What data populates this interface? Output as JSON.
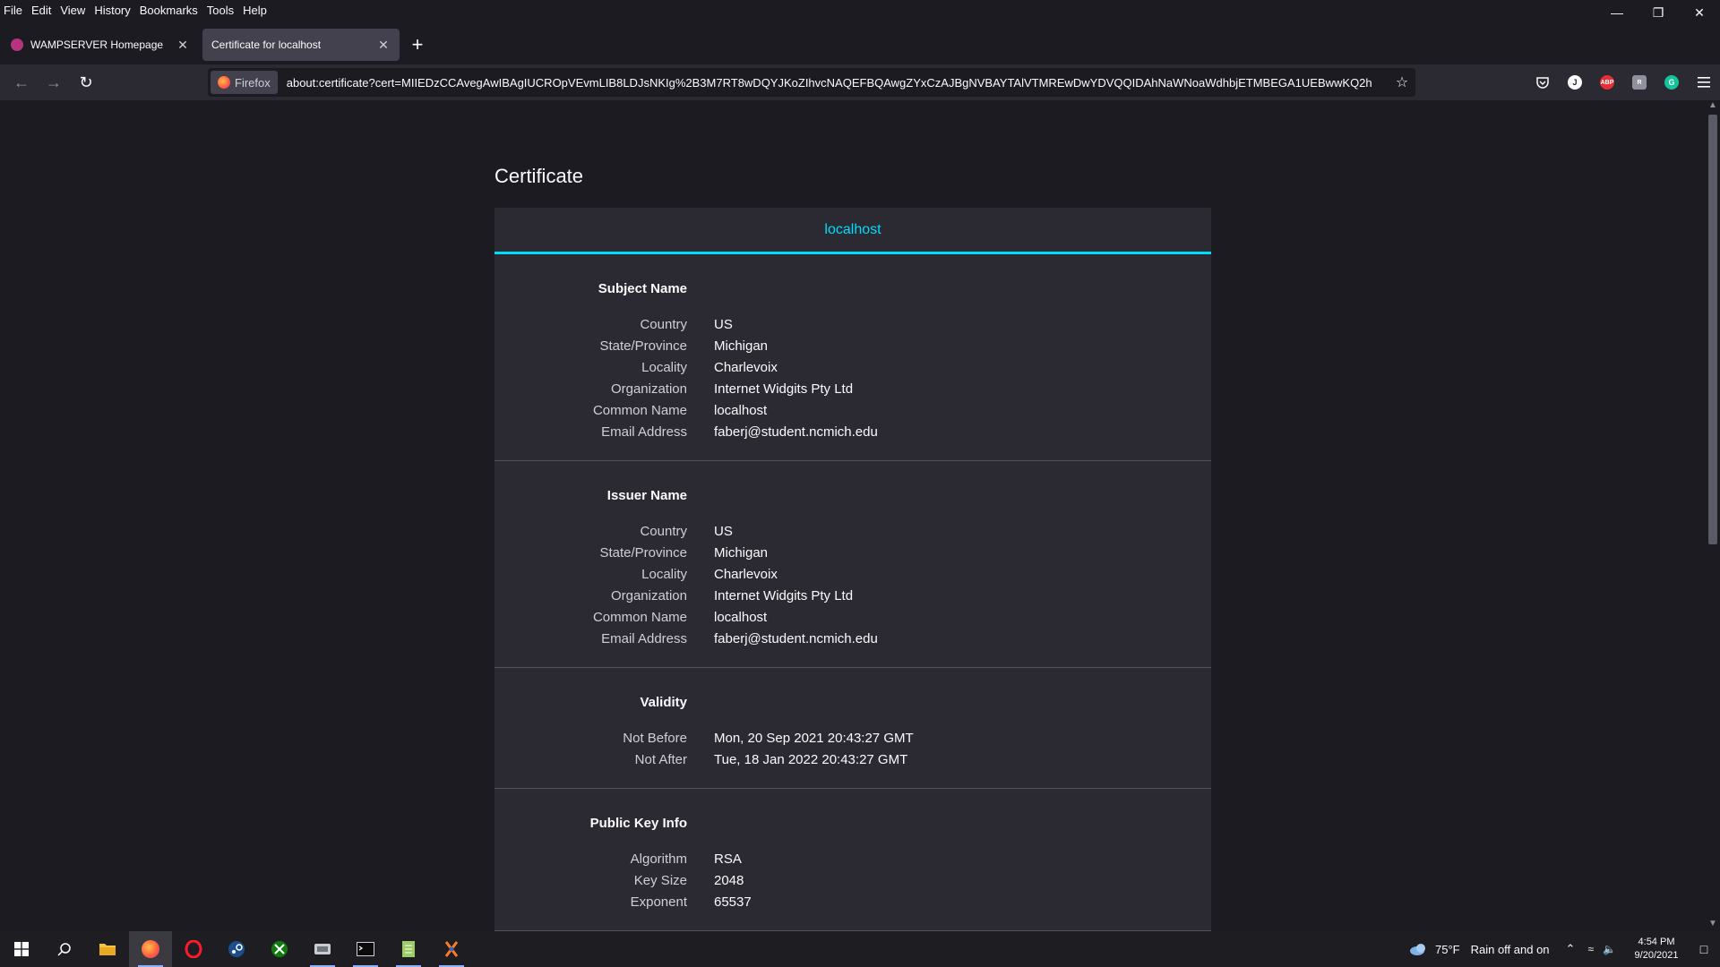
{
  "menu": [
    "File",
    "Edit",
    "View",
    "History",
    "Bookmarks",
    "Tools",
    "Help"
  ],
  "tabs": [
    {
      "label": "WAMPSERVER Homepage",
      "active": false
    },
    {
      "label": "Certificate for localhost",
      "active": true
    }
  ],
  "navbar": {
    "identity_label": "Firefox",
    "url": "about:certificate?cert=MIIEDzCCAvegAwIBAgIUCROpVEvmLIB8LDJsNKIg%2B3M7RT8wDQYJKoZIhvcNAQEFBQAwgZYxCzAJBgNVBAYTAlVTMREwDwYDVQQIDAhNaWNoaWdhbjETMBEGA1UEBwwKQ2h"
  },
  "page": {
    "title": "Certificate",
    "tab_label": "localhost"
  },
  "sections": [
    {
      "title": "Subject Name",
      "rows": [
        {
          "label": "Country",
          "value": "US"
        },
        {
          "label": "State/Province",
          "value": "Michigan"
        },
        {
          "label": "Locality",
          "value": "Charlevoix"
        },
        {
          "label": "Organization",
          "value": "Internet Widgits Pty Ltd"
        },
        {
          "label": "Common Name",
          "value": "localhost"
        },
        {
          "label": "Email Address",
          "value": "faberj@student.ncmich.edu"
        }
      ]
    },
    {
      "title": "Issuer Name",
      "rows": [
        {
          "label": "Country",
          "value": "US"
        },
        {
          "label": "State/Province",
          "value": "Michigan"
        },
        {
          "label": "Locality",
          "value": "Charlevoix"
        },
        {
          "label": "Organization",
          "value": "Internet Widgits Pty Ltd"
        },
        {
          "label": "Common Name",
          "value": "localhost"
        },
        {
          "label": "Email Address",
          "value": "faberj@student.ncmich.edu"
        }
      ]
    },
    {
      "title": "Validity",
      "rows": [
        {
          "label": "Not Before",
          "value": "Mon, 20 Sep 2021 20:43:27 GMT"
        },
        {
          "label": "Not After",
          "value": "Tue, 18 Jan 2022 20:43:27 GMT"
        }
      ]
    },
    {
      "title": "Public Key Info",
      "rows": [
        {
          "label": "Algorithm",
          "value": "RSA"
        },
        {
          "label": "Key Size",
          "value": "2048"
        },
        {
          "label": "Exponent",
          "value": "65537"
        }
      ]
    }
  ],
  "taskbar": {
    "weather": "75°F",
    "weather_text": "Rain off and on",
    "time": "4:54 PM",
    "date": "9/20/2021"
  },
  "colors": {
    "accent": "#00ddff",
    "bg": "#1c1b22",
    "panel": "#2b2a33"
  }
}
